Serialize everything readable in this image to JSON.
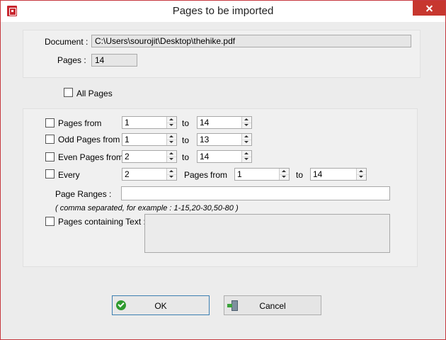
{
  "window": {
    "title": "Pages to be imported"
  },
  "document": {
    "label": "Document :",
    "path": "C:\\Users\\sourojit\\Desktop\\thehike.pdf",
    "pages_label": "Pages :",
    "pages_value": "14"
  },
  "all_pages_label": "All Pages",
  "options": {
    "pages_from": {
      "label": "Pages from",
      "from": "1",
      "to_label": "to",
      "to": "14"
    },
    "odd_pages": {
      "label": "Odd Pages from",
      "from": "1",
      "to_label": "to",
      "to": "13"
    },
    "even_pages": {
      "label": "Even Pages from",
      "from": "2",
      "to_label": "to",
      "to": "14"
    },
    "every": {
      "label": "Every",
      "n": "2",
      "pages_label": "Pages",
      "from_label": "from",
      "from": "1",
      "to_label": "to",
      "to": "14"
    }
  },
  "page_ranges": {
    "label": "Page Ranges :",
    "value": "",
    "hint": "( comma separated, for example : 1-15,20-30,50-80 )"
  },
  "pages_text": {
    "label": "Pages containing Text :",
    "value": ""
  },
  "buttons": {
    "ok": "OK",
    "cancel": "Cancel"
  }
}
